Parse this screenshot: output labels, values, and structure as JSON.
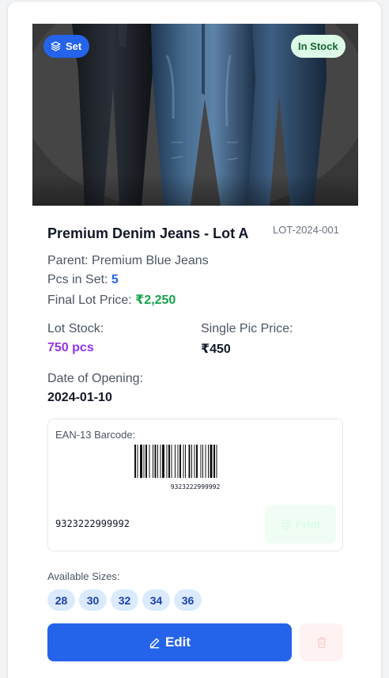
{
  "product": {
    "badge_set": "Set",
    "badge_stock": "In Stock",
    "title": "Premium Denim Jeans - Lot A",
    "lot_code": "LOT-2024-001",
    "parent_label": "Parent: ",
    "parent_value": "Premium Blue Jeans",
    "pcs_label": "Pcs in Set: ",
    "pcs_value": "5",
    "final_price_label": "Final Lot Price: ",
    "final_price_value": "₹2,250",
    "lot_stock_label": "Lot Stock:",
    "lot_stock_value": "750 pcs",
    "single_price_label": "Single Pic Price:",
    "single_price_value": "₹450",
    "date_label": "Date of Opening:",
    "date_value": "2024-01-10"
  },
  "barcode": {
    "label": "EAN-13 Barcode:",
    "digits_small": "9323222999992",
    "number": "9323222999992",
    "print_label": "Print"
  },
  "sizes": {
    "label": "Available Sizes:",
    "items": [
      "28",
      "30",
      "32",
      "34",
      "36"
    ]
  },
  "actions": {
    "edit_label": "Edit"
  },
  "icons": {
    "set": "layers-icon",
    "print": "printer-icon",
    "edit": "pencil-icon",
    "delete": "trash-icon"
  },
  "colors": {
    "primary": "#2563eb",
    "stock_bg": "#dcfce7",
    "stock_text": "#166534",
    "price_green": "#16a34a",
    "stock_purple": "#9333ea",
    "chip_bg": "#dbeafe",
    "delete_bg": "#fef2f2"
  }
}
